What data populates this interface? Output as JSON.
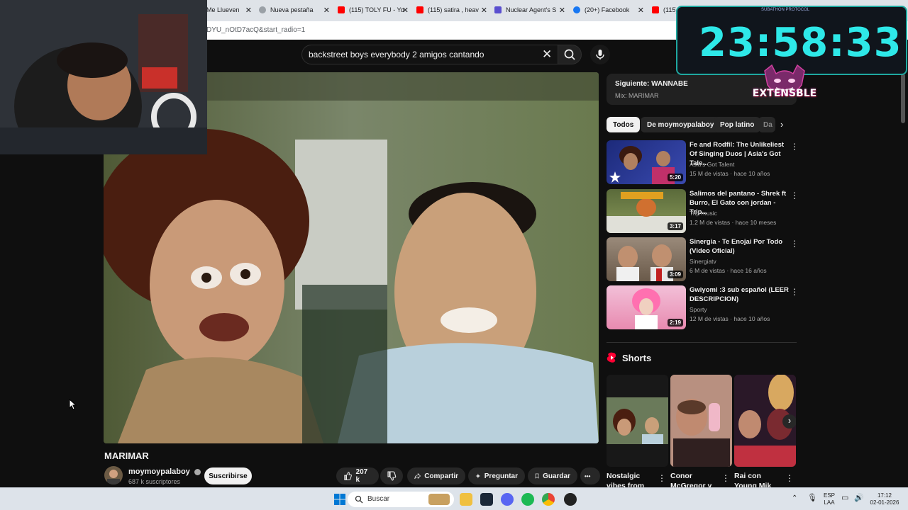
{
  "browser": {
    "tabs": [
      {
        "title": "Me Llueven",
        "fav": "#d0d3d8"
      },
      {
        "title": "Nueva pestaña",
        "fav": "#9aa0a6"
      },
      {
        "title": "(115) TOLY FU - Yo",
        "fav": "#ff0000"
      },
      {
        "title": "(115) satira , heav",
        "fav": "#ff0000"
      },
      {
        "title": "Nuclear Agent's S",
        "fav": "#5a4fcf"
      },
      {
        "title": "(20+) Facebook",
        "fav": "#1877f2"
      },
      {
        "title": "(115)",
        "fav": "#ff0000"
      }
    ],
    "url_fragment": "DYU_nOtD7acQ&start_radio=1"
  },
  "youtube": {
    "search_query": "backstreet boys everybody 2 amigos cantando",
    "video": {
      "title": "MARIMAR",
      "channel": "moymoypalaboy",
      "subscribers": "687 k suscriptores",
      "subscribe_label": "Suscribirse",
      "likes": "207 k",
      "share_label": "Compartir",
      "ask_label": "Preguntar",
      "save_label": "Guardar",
      "more_label": "•••"
    },
    "up_next": {
      "next": "Siguiente: WANNABE",
      "mix": "Mix: MARIMAR"
    },
    "chips": [
      "Todos",
      "De moymoypalaboy",
      "Pop latino",
      "Da"
    ],
    "recommendations": [
      {
        "title": "Fe and Rodfil: The Unlikeliest Of Singing Duos | Asia's Got Tale...",
        "channel": "Asia's Got Talent",
        "meta": "15 M de vistas · hace 10 años",
        "duration": "5:20",
        "thumb": "#2a3a8a"
      },
      {
        "title": "Salimos del pantano - Shrek ft Burro, El Gato con jordan - Trip...",
        "channel": "Trip music",
        "meta": "1.2 M de vistas · hace 10 meses",
        "duration": "3:17",
        "thumb": "#6a7a4a"
      },
      {
        "title": "Sinergia - Te Enojai Por Todo (Video Oficial)",
        "channel": "Sinergiatv",
        "meta": "6 M de vistas · hace 16 años",
        "duration": "3:09",
        "thumb": "#8a6a5a"
      },
      {
        "title": "Gwiyomi :3 sub español (LEER DESCRIPCION)",
        "channel": "Sporty",
        "meta": "12 M de vistas · hace 10 años",
        "duration": "2:19",
        "thumb": "#e8a0c0"
      }
    ],
    "shorts_label": "Shorts",
    "shorts": [
      {
        "title": "Nostalgic vibes from",
        "thumb": "#6a7a5a"
      },
      {
        "title": "Conor McGregor y",
        "thumb": "#b08070"
      },
      {
        "title": "Rai con Young Mik",
        "thumb": "#3a2030"
      }
    ]
  },
  "overlay": {
    "timer": "23:58:33",
    "timer_caption": "SUBATHON PROTOCOL",
    "logo_text": "EXTENSBLE",
    "accent": "#2ee8e8"
  },
  "taskbar": {
    "search_label": "Buscar",
    "lang_top": "ESP",
    "lang_bottom": "LAA",
    "time": "17:12",
    "date": "02-01-2026"
  }
}
